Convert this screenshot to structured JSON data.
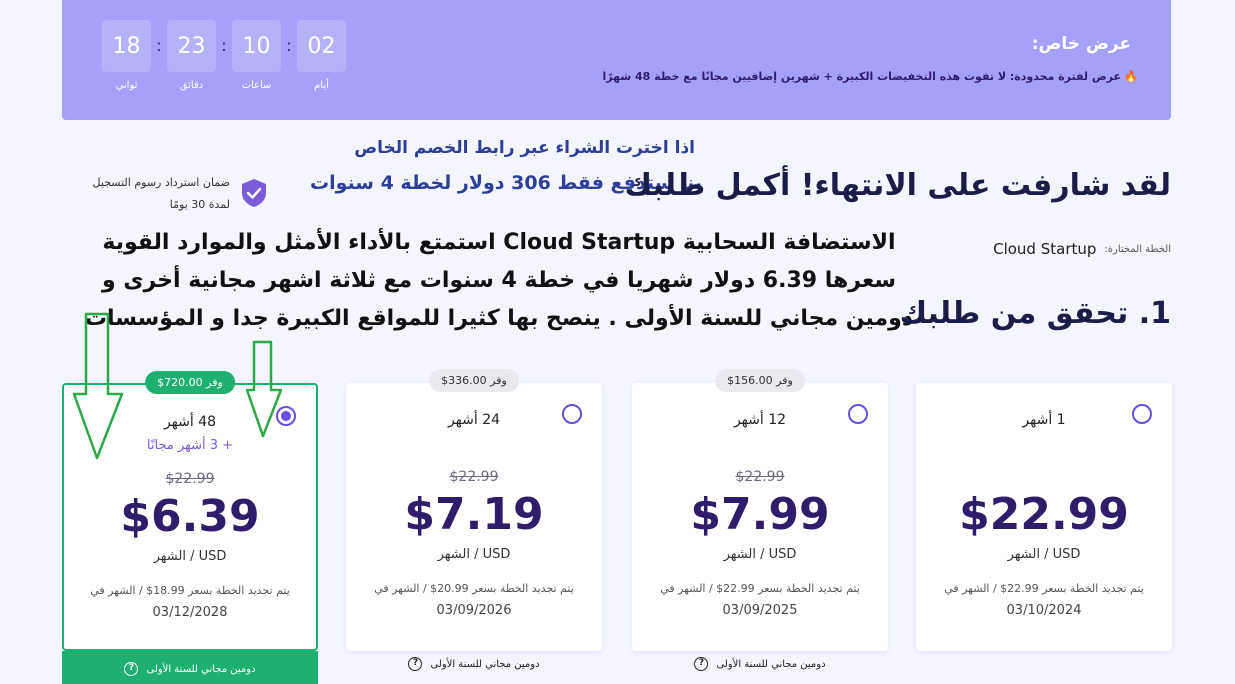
{
  "banner": {
    "title": "عرض خاص:",
    "text": "عرض لفترة محدودة: لا تفوت هذه التخفيضات الكبيرة + شهرين إضافيين مجانًا مع خطة 48 شهرًا",
    "icon": "fire-icon",
    "countdown": [
      {
        "value": "02",
        "label": "أيام"
      },
      {
        "value": "10",
        "label": "ساعات"
      },
      {
        "value": "23",
        "label": "دقائق"
      },
      {
        "value": "18",
        "label": "ثواني"
      }
    ]
  },
  "overlay": {
    "line1": "اذا اخترت الشراء عبر رابط الخصم الخاص",
    "line2": "بنا ستدفع فقط 306 دولار لخطة 4 سنوات",
    "description": "الاستضافة السحابية Cloud Startup استمتع بالأداء الأمثل والموارد القوية سعرها 6.39 دولار شهريا في خطة 4 سنوات مع ثلاثة اشهر مجانية أخرى و دومين مجاني للسنة الأولى . ينصح بها كثيرا للمواقع الكبيرة جدا و المؤسسات"
  },
  "headline": "لقد شارفت على الانتهاء! أكمل طلبك",
  "guarantee": {
    "text": "ضمان استرداد رسوم التسجيل لمدة 30 يومًا",
    "icon": "shield-check-icon"
  },
  "selected_plan": {
    "label": "الخطة المختارة:",
    "value": "Cloud Startup"
  },
  "step_title": "1. تحقق من طلبك",
  "plans": [
    {
      "badge": "وفر 720.00$",
      "period": "48 أشهر",
      "bonus": "+ 3 أشهر مجانًا",
      "old_price": "$22.99",
      "price": "$6.39",
      "unit": "USD / الشهر",
      "renew": "يتم تجديد الخطة بسعر 18.99$ / الشهر في",
      "renew_date": "03/12/2028",
      "footer": "دومين مجاني للسنة الأولى",
      "selected": true
    },
    {
      "badge": "وفر 336.00$",
      "period": "24 أشهر",
      "bonus": "",
      "old_price": "$22.99",
      "price": "$7.19",
      "unit": "USD / الشهر",
      "renew": "يتم تجديد الخطة بسعر 20.99$ / الشهر في",
      "renew_date": "03/09/2026",
      "footer": "دومين مجاني للسنة الأولى",
      "selected": false
    },
    {
      "badge": "وفر 156.00$",
      "period": "12 أشهر",
      "bonus": "",
      "old_price": "$22.99",
      "price": "$7.99",
      "unit": "USD / الشهر",
      "renew": "يتم تجديد الخطة بسعر 22.99$ / الشهر في",
      "renew_date": "03/09/2025",
      "footer": "دومين مجاني للسنة الأولى",
      "selected": false
    },
    {
      "badge": "",
      "period": "1 أشهر",
      "bonus": "",
      "old_price": "",
      "price": "$22.99",
      "unit": "USD / الشهر",
      "renew": "يتم تجديد الخطة بسعر 22.99$ / الشهر في",
      "renew_date": "03/10/2024",
      "footer": "",
      "selected": false
    }
  ],
  "colors": {
    "banner_bg": "#a5a0f8",
    "accent_green": "#1db070",
    "accent_purple": "#6a4de4",
    "price_text": "#2f1c6a",
    "overlay_blue": "#2e3f99"
  }
}
